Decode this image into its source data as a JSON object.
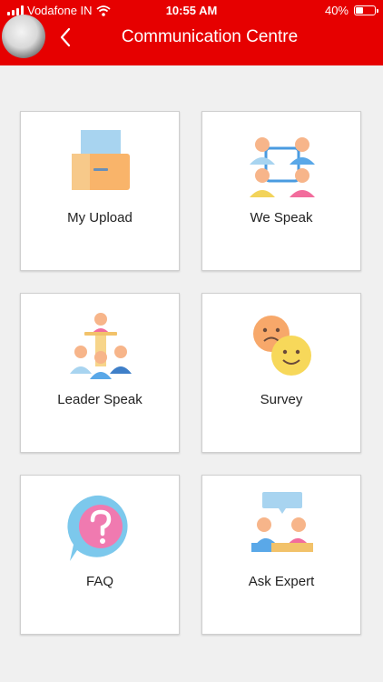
{
  "status_bar": {
    "carrier": "Vodafone IN",
    "time": "10:55 AM",
    "battery": "40%"
  },
  "header": {
    "title": "Communication Centre",
    "back_icon": "chevron-left-icon",
    "background": "#e60000"
  },
  "tiles": [
    {
      "label": "My Upload",
      "icon": "inbox-tray-icon"
    },
    {
      "label": "We Speak",
      "icon": "people-network-icon"
    },
    {
      "label": "Leader Speak",
      "icon": "leader-podium-icon"
    },
    {
      "label": "Survey",
      "icon": "smiley-faces-icon"
    },
    {
      "label": "FAQ",
      "icon": "question-bubble-icon"
    },
    {
      "label": "Ask Expert",
      "icon": "expert-chat-icon"
    }
  ]
}
